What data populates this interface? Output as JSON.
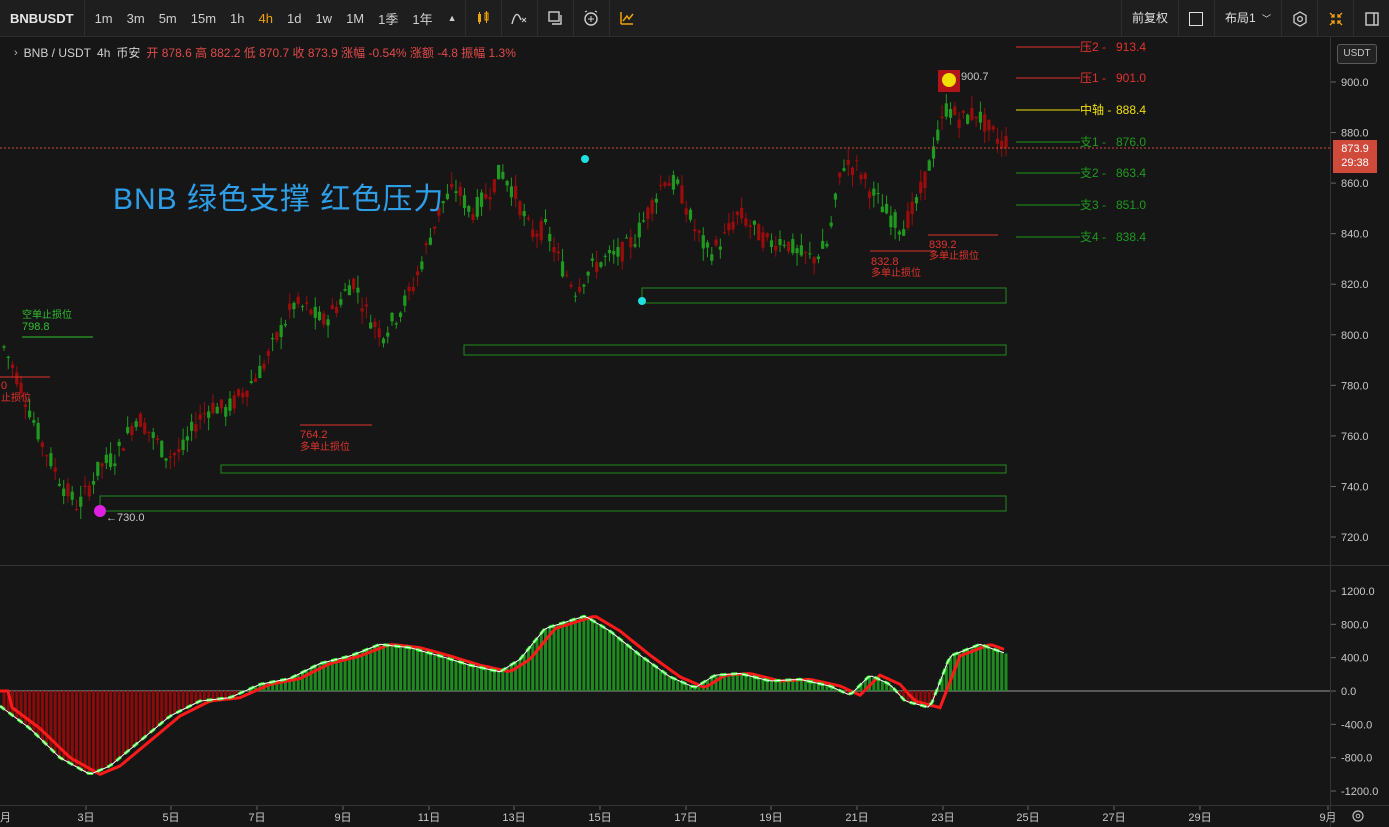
{
  "toolbar": {
    "symbol": "BNBUSDT",
    "intervals": [
      "1m",
      "3m",
      "5m",
      "15m",
      "1h",
      "4h",
      "1d",
      "1w",
      "1M",
      "1季",
      "1年"
    ],
    "active_interval": "4h",
    "adjust_label": "前复权",
    "layout_label": "布局1"
  },
  "legend": {
    "symbol": "BNB / USDT",
    "interval": "4h",
    "exchange": "币安",
    "ohlc": "开 878.6 高 882.2 低 870.7 收 873.9 涨幅 -0.54% 涨额 -4.8 振幅 1.3%"
  },
  "watermark": "BNB  绿色支撑  红色压力",
  "price_scale": {
    "currency": "USDT",
    "ticks": [
      "900.0",
      "880.0",
      "860.0",
      "840.0",
      "820.0",
      "800.0",
      "780.0",
      "760.0",
      "740.0",
      "720.0"
    ],
    "last_price": "873.9",
    "countdown": "29:38"
  },
  "indicator_scale": {
    "ticks": [
      "1200.0",
      "800.0",
      "400.0",
      "0.0",
      "-400.0",
      "-800.0",
      "-1200.0"
    ]
  },
  "time_axis": {
    "ticks": [
      "3日",
      "5日",
      "7日",
      "9日",
      "11日",
      "13日",
      "15日",
      "17日",
      "19日",
      "21日",
      "23日",
      "25日",
      "27日",
      "29日",
      "9月"
    ]
  },
  "levels": [
    {
      "label": "压2 -",
      "value": "913.4",
      "color": "#e0342e"
    },
    {
      "label": "压1 -",
      "value": "901.0",
      "color": "#e0342e"
    },
    {
      "label": "中轴 -",
      "value": "888.4",
      "color": "#f0e000"
    },
    {
      "label": "支1 -",
      "value": "876.0",
      "color": "#1f9a1f"
    },
    {
      "label": "支2 -",
      "value": "863.4",
      "color": "#1f9a1f"
    },
    {
      "label": "支3 -",
      "value": "851.0",
      "color": "#1f9a1f"
    },
    {
      "label": "支4 -",
      "value": "838.4",
      "color": "#1f9a1f"
    }
  ],
  "annotations": {
    "short_stop_title": "空单止损位",
    "short_stop_value": "798.8",
    "left_cut": "0",
    "left_cut_sub": "止损位",
    "long_stop_1_value": "764.2",
    "long_stop_1_label": "多单止损位",
    "long_stop_2_value": "832.8",
    "long_stop_2_label": "多单止损位",
    "long_stop_3_value": "839.2",
    "long_stop_3_label": "多单止损位",
    "high_value": "900.7",
    "low_value": "730.0"
  },
  "colors": {
    "up": "#1f9a1f",
    "down": "#9b0c0c",
    "support": "#1f9a1f",
    "resistance": "#e0342e",
    "axis": "#3a3a3a"
  }
}
